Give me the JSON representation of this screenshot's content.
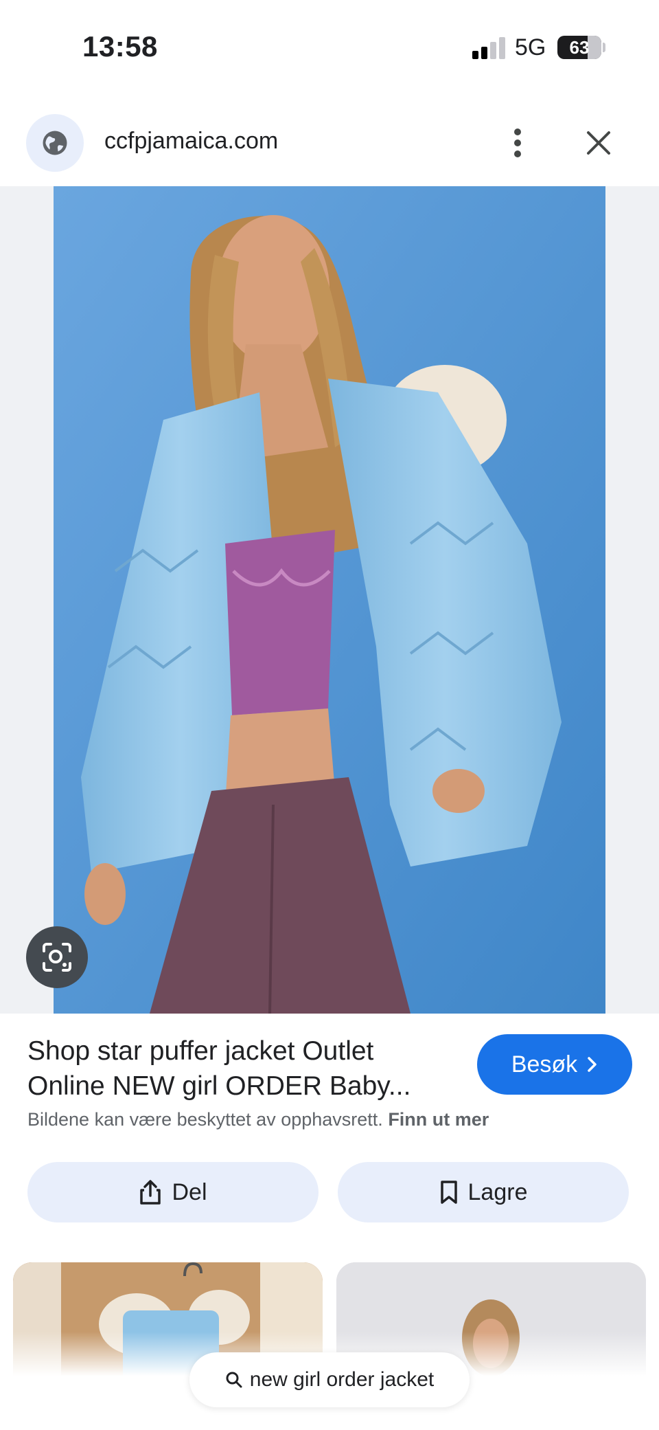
{
  "status_bar": {
    "time": "13:58",
    "network": "5G",
    "battery": "63"
  },
  "browser": {
    "url": "ccfpjamaica.com"
  },
  "result": {
    "title": "Shop star puffer jacket Outlet Online NEW girl ORDER Baby...",
    "visit_label": "Besøk",
    "copyright_text": "Bildene kan være beskyttet av opphavsrett.",
    "learn_more": "Finn ut mer"
  },
  "actions": {
    "share_label": "Del",
    "save_label": "Lagre"
  },
  "search": {
    "query": "new girl order jacket"
  },
  "colors": {
    "accent": "#1a73e8",
    "chip_bg": "#e8eefb",
    "photo_bg": "#4f96d6",
    "jacket": "#8ec3e6",
    "top": "#a05a9e",
    "pants": "#6f4a5a"
  }
}
